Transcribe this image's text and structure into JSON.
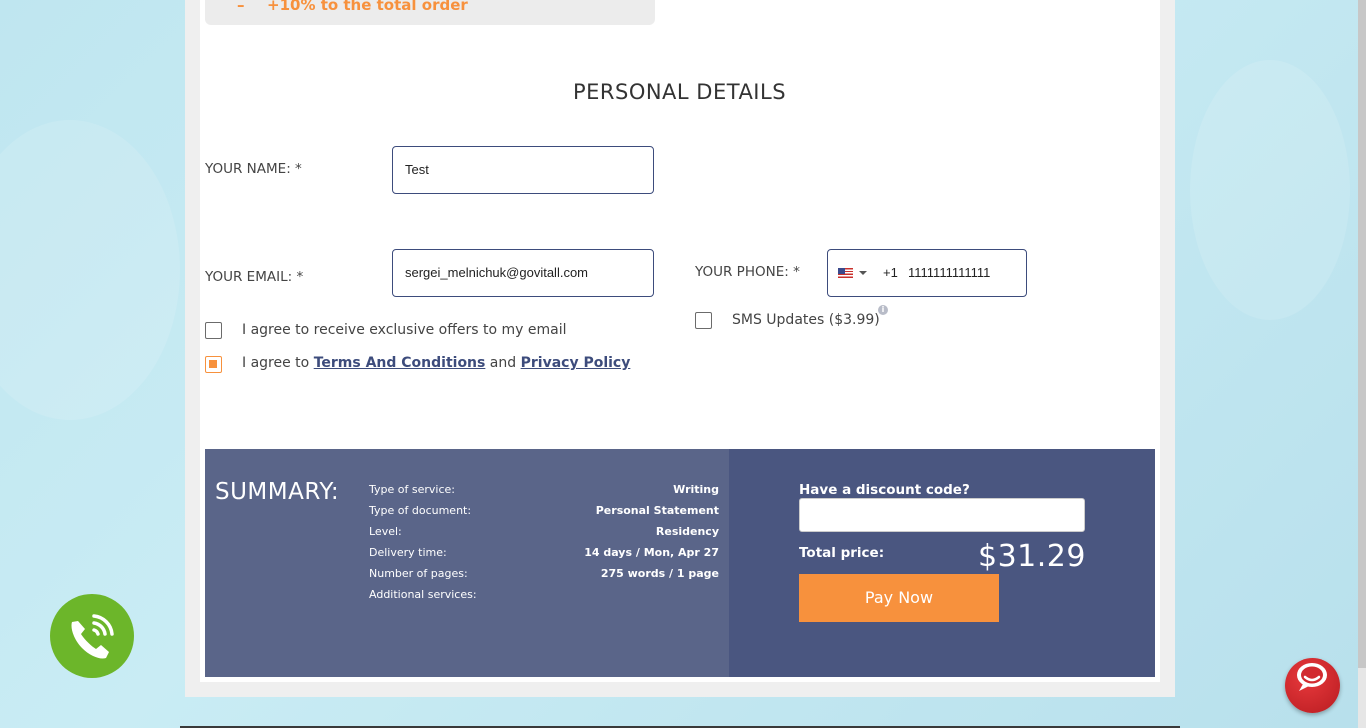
{
  "promo": {
    "dash": "–",
    "text": "+10% to the total order"
  },
  "section_title": "PERSONAL DETAILS",
  "name": {
    "label": "YOUR NAME: *",
    "value": "Test"
  },
  "email": {
    "label": "YOUR EMAIL: *",
    "value": "sergei_melnichuk@govitall.com"
  },
  "phone": {
    "label": "YOUR PHONE: *",
    "country_code": "+1",
    "value": "1111111111111",
    "flag": "us-flag-icon"
  },
  "sms": {
    "label": "SMS Updates ($3.99)",
    "checked": false
  },
  "offers": {
    "label": "I agree to receive exclusive offers to my email",
    "checked": false
  },
  "terms": {
    "prefix": "I agree to ",
    "terms_link": "Terms And Conditions",
    "middle": " and ",
    "privacy_link": "Privacy Policy",
    "checked": true
  },
  "summary": {
    "title": "SUMMARY:",
    "rows": [
      {
        "k": "Type of service:",
        "v": "Writing"
      },
      {
        "k": "Type of document:",
        "v": "Personal Statement"
      },
      {
        "k": "Level:",
        "v": "Residency"
      },
      {
        "k": "Delivery time:",
        "v": "14 days / Mon, Apr 27"
      },
      {
        "k": "Number of pages:",
        "v": "275 words / 1 page"
      },
      {
        "k": "Additional services:",
        "v": ""
      }
    ]
  },
  "discount": {
    "label": "Have a discount code?",
    "value": ""
  },
  "total": {
    "label": "Total price:",
    "price": "$31.29"
  },
  "pay_button": "Pay Now",
  "colors": {
    "accent": "#f7913d",
    "navy": "#4a5680",
    "green": "#6cb62a",
    "red": "#d22a2f"
  }
}
